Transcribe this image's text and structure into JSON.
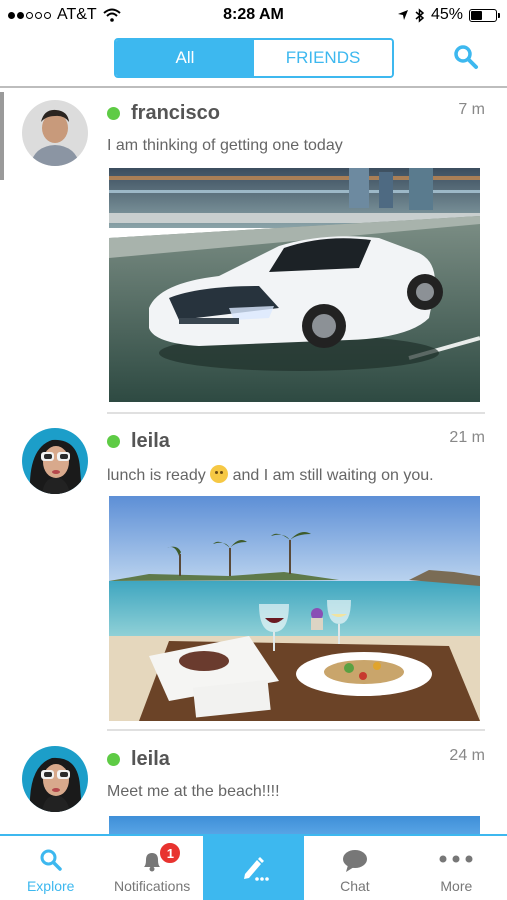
{
  "status_bar": {
    "carrier": "AT&T",
    "time": "8:28 AM",
    "battery": "45%",
    "battery_level": 0.45,
    "icons": [
      "wifi-icon",
      "location-arrow-icon",
      "bluetooth-icon",
      "battery-icon"
    ]
  },
  "header": {
    "tabs": [
      {
        "label": "All",
        "active": true
      },
      {
        "label": "FRIENDS",
        "active": false
      }
    ],
    "search_icon": "search-icon"
  },
  "posts": [
    {
      "username": "francisco",
      "time": "7 m",
      "message": "I am thinking of getting one today",
      "online": true,
      "photo": "car-photo"
    },
    {
      "username": "leila",
      "time": "21 m",
      "message_before": "lunch is ready",
      "message_after": "and I am still waiting on you.",
      "emoji": "smiling-face-emoji",
      "online": true,
      "photo": "beach-lunch-photo"
    },
    {
      "username": "leila",
      "time": "24 m",
      "message": "Meet me at the beach!!!!",
      "online": true,
      "photo": "beach-photo"
    }
  ],
  "tabbar": {
    "items": [
      {
        "label": "Explore",
        "icon": "search-icon",
        "active": true
      },
      {
        "label": "Notifications",
        "icon": "bell-icon",
        "badge": "1"
      },
      {
        "label": "",
        "icon": "pencil-compose-icon"
      },
      {
        "label": "Chat",
        "icon": "chat-bubble-icon"
      },
      {
        "label": "More",
        "icon": "more-dots-icon"
      }
    ]
  },
  "colors": {
    "accent": "#3db8ef",
    "online": "#5ecb45",
    "badge": "#e8332f"
  }
}
